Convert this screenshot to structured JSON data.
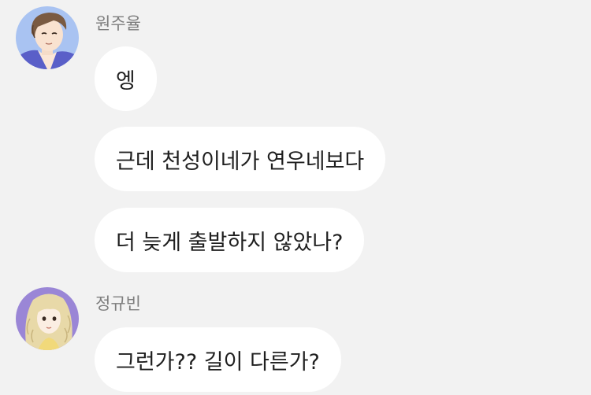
{
  "colors": {
    "background": "#f2f2f2",
    "bubble": "#ffffff",
    "sender_name": "#7d7d7d",
    "message_text": "#1f1f1f"
  },
  "thread": [
    {
      "sender": "원주율",
      "avatar_icon": "boy-avatar-icon",
      "messages": [
        "엥",
        "근데 천성이네가 연우네보다",
        "더 늦게 출발하지 않았나?"
      ]
    },
    {
      "sender": "정규빈",
      "avatar_icon": "girl-avatar-icon",
      "messages": [
        "그런가?? 길이 다른가?"
      ]
    }
  ]
}
